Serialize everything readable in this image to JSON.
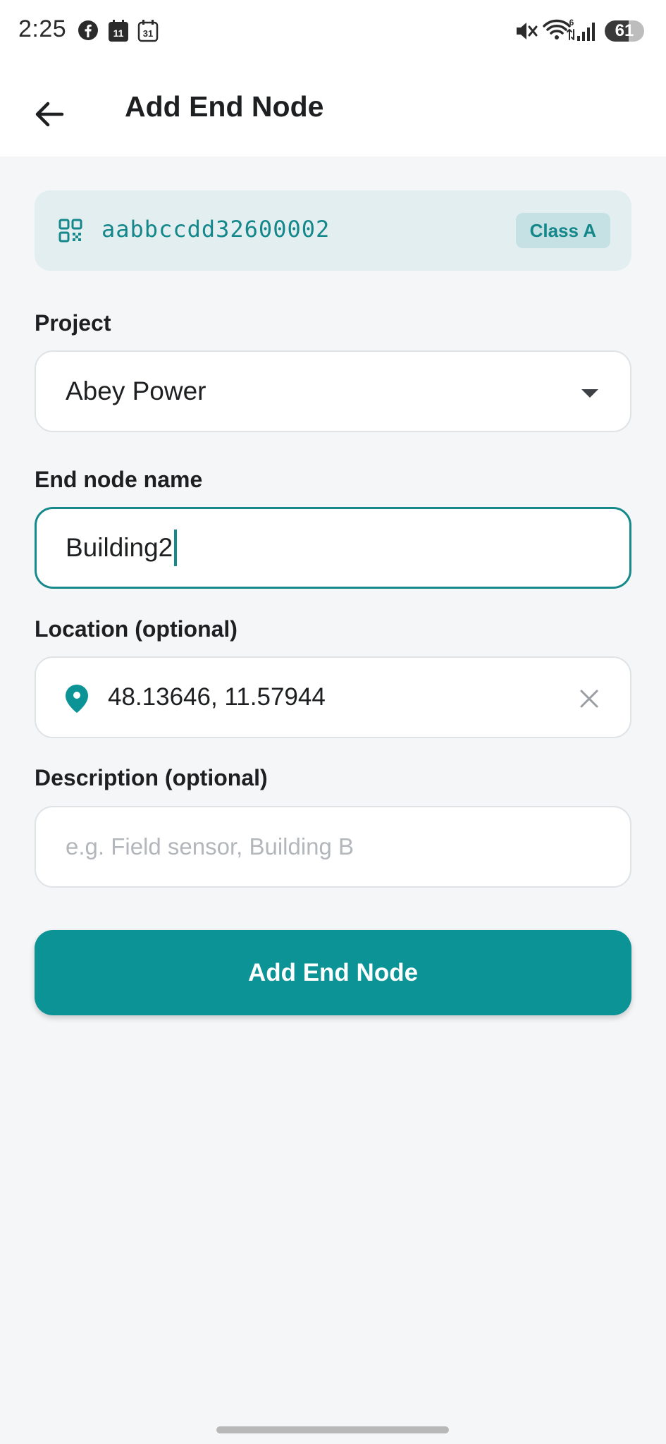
{
  "status_bar": {
    "time": "2:25",
    "battery_level": "61",
    "icons": [
      "facebook-icon",
      "calendar-11-icon",
      "calendar-31-icon",
      "mute-icon",
      "wifi-icon",
      "signal-icon",
      "battery-icon"
    ],
    "calendar_day_1": "11",
    "calendar_day_2": "31",
    "wifi_badge": "6"
  },
  "app_bar": {
    "title": "Add End Node",
    "back_icon": "arrow-left-icon"
  },
  "device": {
    "eui": "aabbccdd32600002",
    "class_badge": "Class A",
    "icon": "qr-code-icon"
  },
  "form": {
    "project": {
      "label": "Project",
      "value": "Abey Power"
    },
    "name": {
      "label": "End node name",
      "value": "Building2"
    },
    "location": {
      "label": "Location (optional)",
      "value": "48.13646, 11.57944"
    },
    "description": {
      "label": "Description (optional)",
      "value": "",
      "placeholder": "e.g. Field sensor, Building B"
    },
    "submit_label": "Add End Node"
  },
  "colors": {
    "accent": "#0b9396",
    "accent_text": "#14878a",
    "card_bg": "#e3eef0",
    "page_bg": "#f4f6f8"
  }
}
